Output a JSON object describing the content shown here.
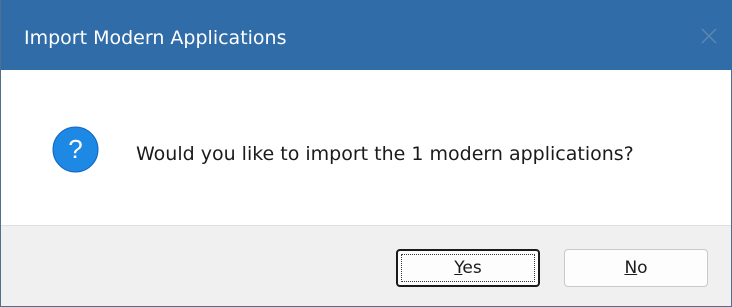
{
  "window": {
    "title": "Import Modern Applications",
    "close_icon": "close-icon"
  },
  "message": {
    "icon": "question-icon",
    "text": "Would you like to import the 1 modern applications?"
  },
  "buttons": {
    "yes": {
      "mnemonic": "Y",
      "rest": "es",
      "focused": true
    },
    "no": {
      "mnemonic": "N",
      "rest": "o",
      "focused": false
    }
  },
  "colors": {
    "titlebar": "#2f6ca8",
    "icon_blue": "#1e88e5",
    "footer": "#f0f0f0"
  }
}
